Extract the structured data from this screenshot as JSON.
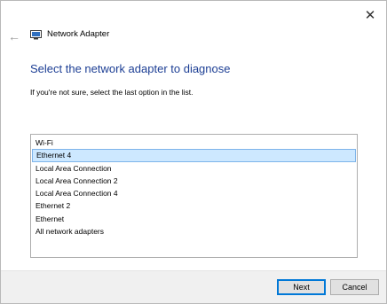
{
  "window": {
    "close_glyph": "✕"
  },
  "header": {
    "back_glyph": "←",
    "icon": "network-adapter-icon",
    "title": "Network Adapter"
  },
  "main": {
    "heading": "Select the network adapter to diagnose",
    "instruction": "If you're not sure, select the last option in the list.",
    "adapters": [
      {
        "label": "Wi-Fi",
        "selected": false
      },
      {
        "label": "Ethernet 4",
        "selected": true
      },
      {
        "label": "Local Area Connection",
        "selected": false
      },
      {
        "label": "Local Area Connection 2",
        "selected": false
      },
      {
        "label": "Local Area Connection 4",
        "selected": false
      },
      {
        "label": "Ethernet 2",
        "selected": false
      },
      {
        "label": "Ethernet",
        "selected": false
      },
      {
        "label": "All network adapters",
        "selected": false
      }
    ]
  },
  "footer": {
    "next_label": "Next",
    "cancel_label": "Cancel"
  },
  "colors": {
    "heading": "#1c3e94",
    "selection_bg": "#cde8ff",
    "selection_border": "#7eb4ea",
    "default_button_border": "#0078d7"
  }
}
